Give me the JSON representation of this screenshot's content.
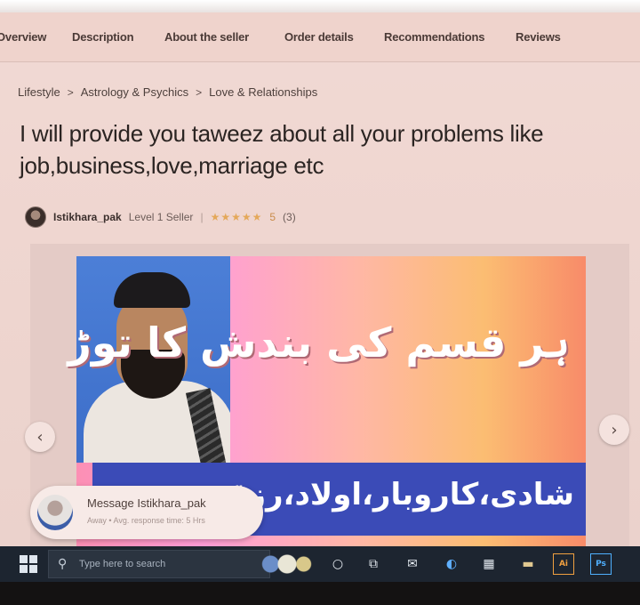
{
  "nav": {
    "tabs": [
      "Overview",
      "Description",
      "About the seller",
      "Order details",
      "Recommendations",
      "Reviews"
    ]
  },
  "breadcrumb": [
    "Lifestyle",
    "Astrology & Psychics",
    "Love & Relationships"
  ],
  "title": "I will provide you taweez about all your problems like job,business,love,marriage etc",
  "seller": {
    "name": "Istikhara_pak",
    "level": "Level 1 Seller",
    "stars": "★★★★★",
    "rating": "5",
    "rating_count": "(3)"
  },
  "gallery": {
    "urdu_headline": "ہر قسم کی بندش کا توڑ",
    "urdu_band": "شادی،کاروبار،اولاد،رزق",
    "prev_icon": "chevron-left-icon",
    "next_icon": "chevron-right-icon"
  },
  "message": {
    "title": "Message Istikhara_pak",
    "status": "Away",
    "response": "Avg. response time: 5 Hrs"
  },
  "taskbar": {
    "search_placeholder": "Type here to search",
    "ai_label": "Ai",
    "ps_label": "Ps"
  },
  "colors": {
    "screen_tint": "#efd6d0",
    "blue_band": "#3b4bb7",
    "star": "#e4a85a",
    "taskbar": "#1d2530"
  }
}
